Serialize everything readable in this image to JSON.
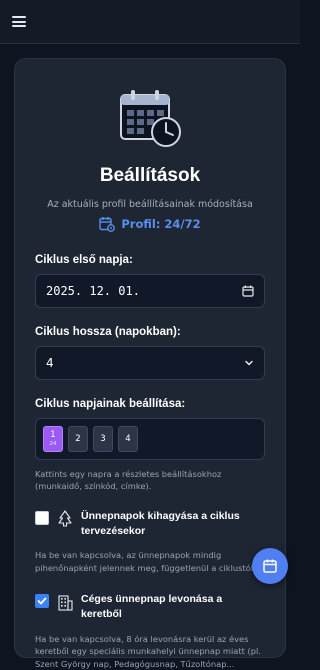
{
  "topbar": {
    "menu_icon": "hamburger-menu-icon"
  },
  "settings": {
    "hero_icon": "calendar-clock-icon",
    "title": "Beállítások",
    "subtitle": "Az aktuális profil beállításainak módosítása",
    "profile_icon": "calendar-gear-icon",
    "profile_label": "Profil: 24/72",
    "cycle_start": {
      "label": "Ciklus első napja:",
      "value": "2025. 12. 01."
    },
    "cycle_length": {
      "label": "Ciklus hossza (napokban):",
      "value": "4"
    },
    "cycle_days": {
      "label": "Ciklus napjainak beállítása:",
      "days": [
        {
          "num": "1",
          "sub": "24",
          "active": true
        },
        {
          "num": "2",
          "sub": "",
          "active": false
        },
        {
          "num": "3",
          "sub": "",
          "active": false
        },
        {
          "num": "4",
          "sub": "",
          "active": false
        }
      ],
      "hint": "Kattints egy napra a részletes beállításokhoz (munkaidő, színkód, címke)."
    },
    "skip_holidays": {
      "checked": false,
      "icon": "tree-icon",
      "label": "Ünnepnapok kihagyása a ciklus tervezésekor",
      "hint": "Ha be van kapcsolva, az ünnepnapok mindig pihenőnapként jelennek meg, függetlenül a ciklustól."
    },
    "company_holiday": {
      "checked": true,
      "icon": "building-icon",
      "label": "Céges ünnepnap levonása a keretből",
      "hint": "Ha be van kapcsolva, 8 óra levonásra kerül az éves keretből egy speciális munkahelyi ünnepnap miatt (pl. Szent György nap, Pedagógusnap, Tűzoltónap..."
    }
  },
  "fab": {
    "icon": "calendar-icon"
  },
  "colors": {
    "accent": "#5b8def",
    "active_day": "#9b59f5",
    "fab": "#4f7ff0"
  }
}
